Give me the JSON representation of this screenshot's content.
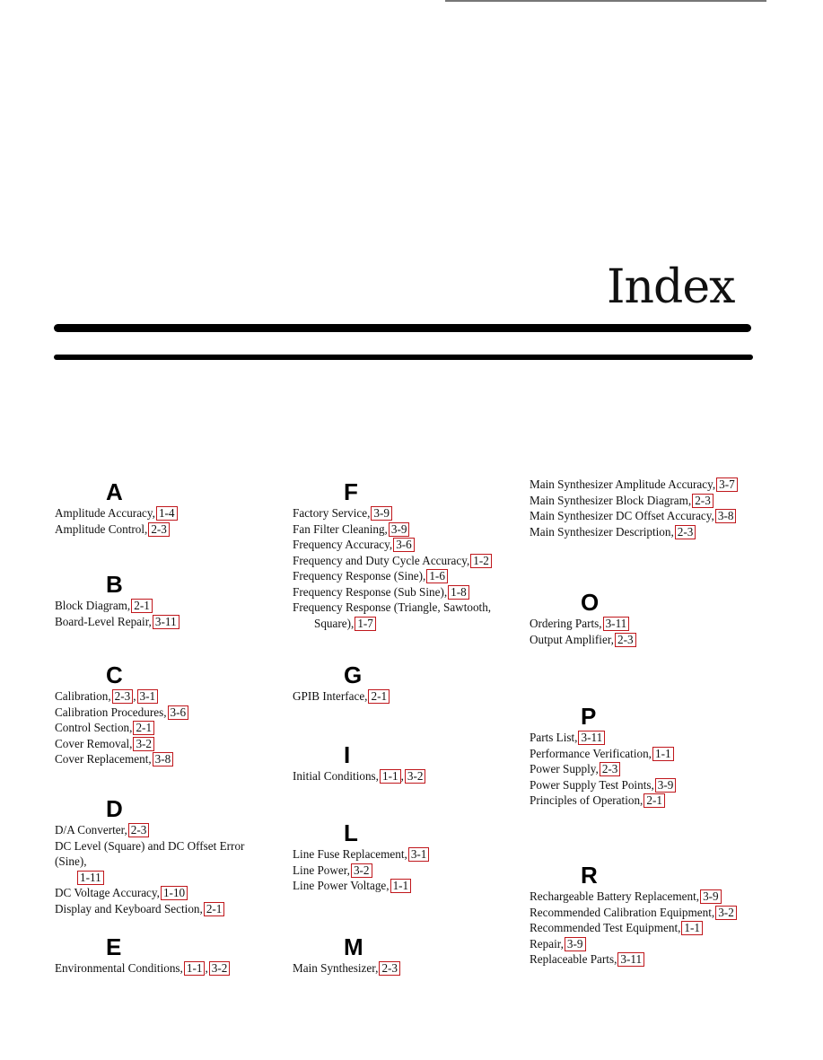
{
  "page": {
    "title": "Index"
  },
  "columns": [
    {
      "sections": [
        {
          "letter": "A",
          "entries": [
            {
              "term": "Amplitude Accuracy,",
              "refs": [
                "1-4"
              ]
            },
            {
              "term": "Amplitude Control,",
              "refs": [
                "2-3"
              ]
            }
          ]
        },
        {
          "letter": "B",
          "entries": [
            {
              "term": "Block Diagram,",
              "refs": [
                "2-1"
              ]
            },
            {
              "term": "Board-Level Repair,",
              "refs": [
                "3-11"
              ]
            }
          ]
        },
        {
          "letter": "C",
          "entries": [
            {
              "term": "Calibration,",
              "refs": [
                "2-3",
                "3-1"
              ]
            },
            {
              "term": "Calibration Procedures,",
              "refs": [
                "3-6"
              ]
            },
            {
              "term": "Control Section,",
              "refs": [
                "2-1"
              ]
            },
            {
              "term": "Cover Removal,",
              "refs": [
                "3-2"
              ]
            },
            {
              "term": "Cover Replacement,",
              "refs": [
                "3-8"
              ]
            }
          ]
        },
        {
          "letter": "D",
          "entries": [
            {
              "term": "D/A Converter,",
              "refs": [
                "2-3"
              ]
            },
            {
              "term": "DC Level (Square) and DC Offset Error (Sine),",
              "refs": [
                "1-11"
              ],
              "wrap": true
            },
            {
              "term": "DC Voltage Accuracy,",
              "refs": [
                "1-10"
              ]
            },
            {
              "term": "Display and Keyboard Section,",
              "refs": [
                "2-1"
              ]
            }
          ]
        },
        {
          "letter": "E",
          "entries": [
            {
              "term": "Environmental Conditions,",
              "refs": [
                "1-1",
                "3-2"
              ]
            }
          ]
        }
      ]
    },
    {
      "sections": [
        {
          "letter": "F",
          "entries": [
            {
              "term": "Factory Service,",
              "refs": [
                "3-9"
              ]
            },
            {
              "term": "Fan Filter Cleaning,",
              "refs": [
                "3-9"
              ]
            },
            {
              "term": "Frequency Accuracy,",
              "refs": [
                "3-6"
              ]
            },
            {
              "term": "Frequency and Duty Cycle Accuracy,",
              "refs": [
                "1-2"
              ]
            },
            {
              "term": "Frequency Response (Sine),",
              "refs": [
                "1-6"
              ]
            },
            {
              "term": "Frequency Response (Sub Sine),",
              "refs": [
                "1-8"
              ]
            },
            {
              "term": "Frequency Response (Triangle, Sawtooth,",
              "term_cont": "Square),",
              "refs": [
                "1-7"
              ],
              "wrap": true
            }
          ]
        },
        {
          "letter": "G",
          "entries": [
            {
              "term": "GPIB Interface,",
              "refs": [
                "2-1"
              ]
            }
          ]
        },
        {
          "letter": "I",
          "entries": [
            {
              "term": "Initial Conditions,",
              "refs": [
                "1-1",
                "3-2"
              ]
            }
          ]
        },
        {
          "letter": "L",
          "entries": [
            {
              "term": "Line Fuse Replacement,",
              "refs": [
                "3-1"
              ]
            },
            {
              "term": "Line Power,",
              "refs": [
                "3-2"
              ]
            },
            {
              "term": "Line Power Voltage,",
              "refs": [
                "1-1"
              ]
            }
          ]
        },
        {
          "letter": "M",
          "entries": [
            {
              "term": "Main Synthesizer,",
              "refs": [
                "2-3"
              ]
            }
          ]
        }
      ]
    },
    {
      "sections": [
        {
          "letter": "",
          "entries": [
            {
              "term": "Main Synthesizer Amplitude Accuracy,",
              "refs": [
                "3-7"
              ]
            },
            {
              "term": "Main Synthesizer Block Diagram,",
              "refs": [
                "2-3"
              ]
            },
            {
              "term": "Main Synthesizer DC Offset Accuracy,",
              "refs": [
                "3-8"
              ]
            },
            {
              "term": "Main Synthesizer Description,",
              "refs": [
                "2-3"
              ]
            }
          ]
        },
        {
          "letter": "O",
          "entries": [
            {
              "term": "Ordering Parts,",
              "refs": [
                "3-11"
              ]
            },
            {
              "term": "Output Amplifier,",
              "refs": [
                "2-3"
              ]
            }
          ]
        },
        {
          "letter": "P",
          "entries": [
            {
              "term": "Parts List,",
              "refs": [
                "3-11"
              ]
            },
            {
              "term": "Performance Verification,",
              "refs": [
                "1-1"
              ]
            },
            {
              "term": "Power Supply,",
              "refs": [
                "2-3"
              ]
            },
            {
              "term": "Power Supply Test Points,",
              "refs": [
                "3-9"
              ]
            },
            {
              "term": "Principles of Operation,",
              "refs": [
                "2-1"
              ]
            }
          ]
        },
        {
          "letter": "R",
          "entries": [
            {
              "term": "Rechargeable Battery Replacement,",
              "refs": [
                "3-9"
              ]
            },
            {
              "term": "Recommended Calibration Equipment,",
              "refs": [
                "3-2"
              ]
            },
            {
              "term": "Recommended Test Equipment,",
              "refs": [
                "1-1"
              ]
            },
            {
              "term": "Repair,",
              "refs": [
                "3-9"
              ]
            },
            {
              "term": "Replaceable Parts,",
              "refs": [
                "3-11"
              ]
            }
          ]
        }
      ]
    }
  ]
}
